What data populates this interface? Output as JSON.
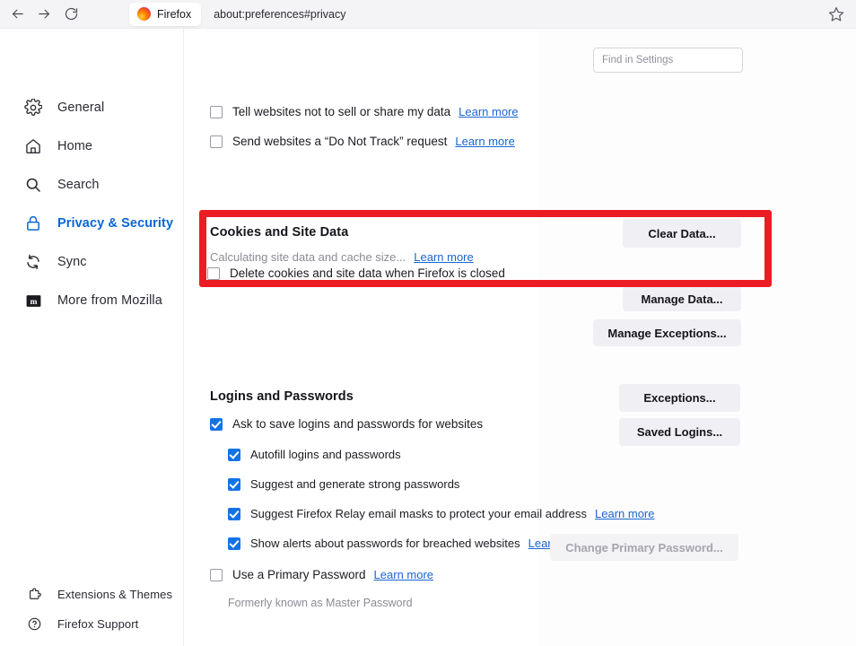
{
  "browser": {
    "back_icon": "back-arrow-icon",
    "forward_icon": "forward-arrow-icon",
    "reload_icon": "reload-icon",
    "tab_title": "Firefox",
    "url": "about:preferences#privacy",
    "bookmark_icon": "star-icon"
  },
  "search": {
    "placeholder": "Find in Settings"
  },
  "sidebar": {
    "items": [
      {
        "label": "General",
        "icon": "gear-icon",
        "active": false
      },
      {
        "label": "Home",
        "icon": "home-icon",
        "active": false
      },
      {
        "label": "Search",
        "icon": "search-icon",
        "active": false
      },
      {
        "label": "Privacy & Security",
        "icon": "lock-icon",
        "active": true
      },
      {
        "label": "Sync",
        "icon": "sync-icon",
        "active": false
      },
      {
        "label": "More from Mozilla",
        "icon": "mozilla-icon",
        "active": false
      }
    ],
    "bottom_items": [
      {
        "label": "Extensions & Themes",
        "icon": "puzzle-icon"
      },
      {
        "label": "Firefox Support",
        "icon": "question-circle-icon"
      }
    ]
  },
  "main": {
    "tracking_rows": [
      {
        "label": "Tell websites not to sell or share my data",
        "checked": false,
        "link": "Learn more"
      },
      {
        "label": "Send websites a “Do Not Track” request",
        "checked": false,
        "link": "Learn more"
      }
    ],
    "cookies": {
      "title": "Cookies and Site Data",
      "status": "Calculating site data and cache size...",
      "link": "Learn more",
      "clear_button": "Clear Data...",
      "manage_button": "Manage Data...",
      "exceptions_button": "Manage Exceptions...",
      "delete_on_close_label": "Delete cookies and site data when Firefox is closed",
      "delete_on_close_checked": false,
      "highlight_color": "#ec1c24"
    },
    "logins": {
      "title": "Logins and Passwords",
      "rows": [
        {
          "label": "Ask to save logins and passwords for websites",
          "checked": true,
          "link": "",
          "indent": 0
        },
        {
          "label": "Autofill logins and passwords",
          "checked": true,
          "link": "",
          "indent": 1
        },
        {
          "label": "Suggest and generate strong passwords",
          "checked": true,
          "link": "",
          "indent": 1
        },
        {
          "label": "Suggest Firefox Relay email masks to protect your email address",
          "checked": true,
          "link": "Learn more",
          "indent": 1
        },
        {
          "label": "Show alerts about passwords for breached websites",
          "checked": true,
          "link": "Learn more",
          "indent": 1
        }
      ],
      "exceptions_button": "Exceptions...",
      "saved_logins_button": "Saved Logins...",
      "primary_password_label": "Use a Primary Password",
      "primary_password_link": "Learn more",
      "primary_password_checked": false,
      "primary_password_note": "Formerly known as Master Password",
      "change_primary_button": "Change Primary Password..."
    }
  }
}
